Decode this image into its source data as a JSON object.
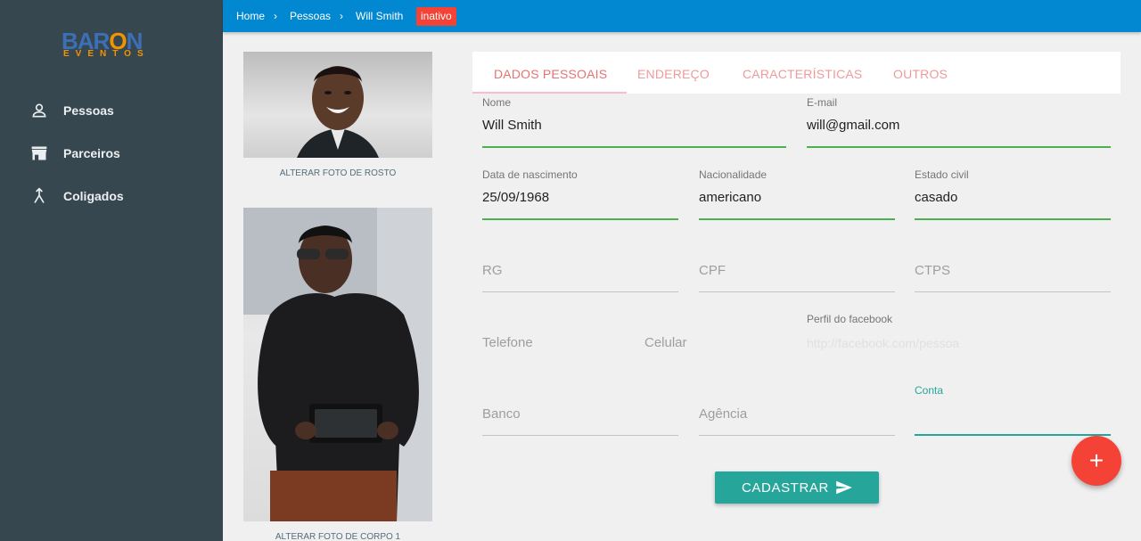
{
  "logo": {
    "main_left": "BAR",
    "main_o": "O",
    "main_right": "N",
    "sub": "EVENTOS"
  },
  "sidebar": {
    "items": [
      {
        "label": "Pessoas",
        "icon": "person-icon"
      },
      {
        "label": "Parceiros",
        "icon": "store-icon"
      },
      {
        "label": "Coligados",
        "icon": "merge-icon"
      }
    ]
  },
  "breadcrumb": {
    "items": [
      "Home",
      "Pessoas",
      "Will Smith"
    ],
    "separator": "›",
    "status_badge": "inativo"
  },
  "photos": {
    "face_caption": "ALTERAR FOTO DE ROSTO",
    "body_caption": "ALTERAR FOTO DE CORPO 1"
  },
  "tabs": [
    {
      "label": "DADOS PESSOAIS",
      "active": true
    },
    {
      "label": "ENDEREÇO",
      "active": false
    },
    {
      "label": "CARACTERÍSTICAS",
      "active": false
    },
    {
      "label": "OUTROS",
      "active": false
    }
  ],
  "form": {
    "nome": {
      "label": "Nome",
      "value": "Will Smith"
    },
    "email": {
      "label": "E-mail",
      "value": "will@gmail.com"
    },
    "nascimento": {
      "label": "Data de nascimento",
      "value": "25/09/1968"
    },
    "nacionalidade": {
      "label": "Nacionalidade",
      "value": "americano"
    },
    "estado_civil": {
      "label": "Estado civil",
      "value": "casado"
    },
    "rg": {
      "placeholder": "RG"
    },
    "cpf": {
      "placeholder": "CPF"
    },
    "ctps": {
      "placeholder": "CTPS"
    },
    "telefone": {
      "placeholder": "Telefone"
    },
    "celular": {
      "placeholder": "Celular"
    },
    "facebook": {
      "label": "Perfil do facebook",
      "placeholder": "http://facebook.com/pessoa"
    },
    "banco": {
      "placeholder": "Banco"
    },
    "agencia": {
      "placeholder": "Agência"
    },
    "conta": {
      "label": "Conta",
      "value": ""
    }
  },
  "actions": {
    "submit_label": "CADASTRAR",
    "fab_label": "+"
  },
  "colors": {
    "sidebar_bg": "#37474f",
    "topbar_bg": "#0288d1",
    "badge_bg": "#f44336",
    "accent_teal": "#26a69a",
    "filled_underline": "#4caf50",
    "tab_text": "#e57373",
    "fab_bg": "#f44336"
  }
}
